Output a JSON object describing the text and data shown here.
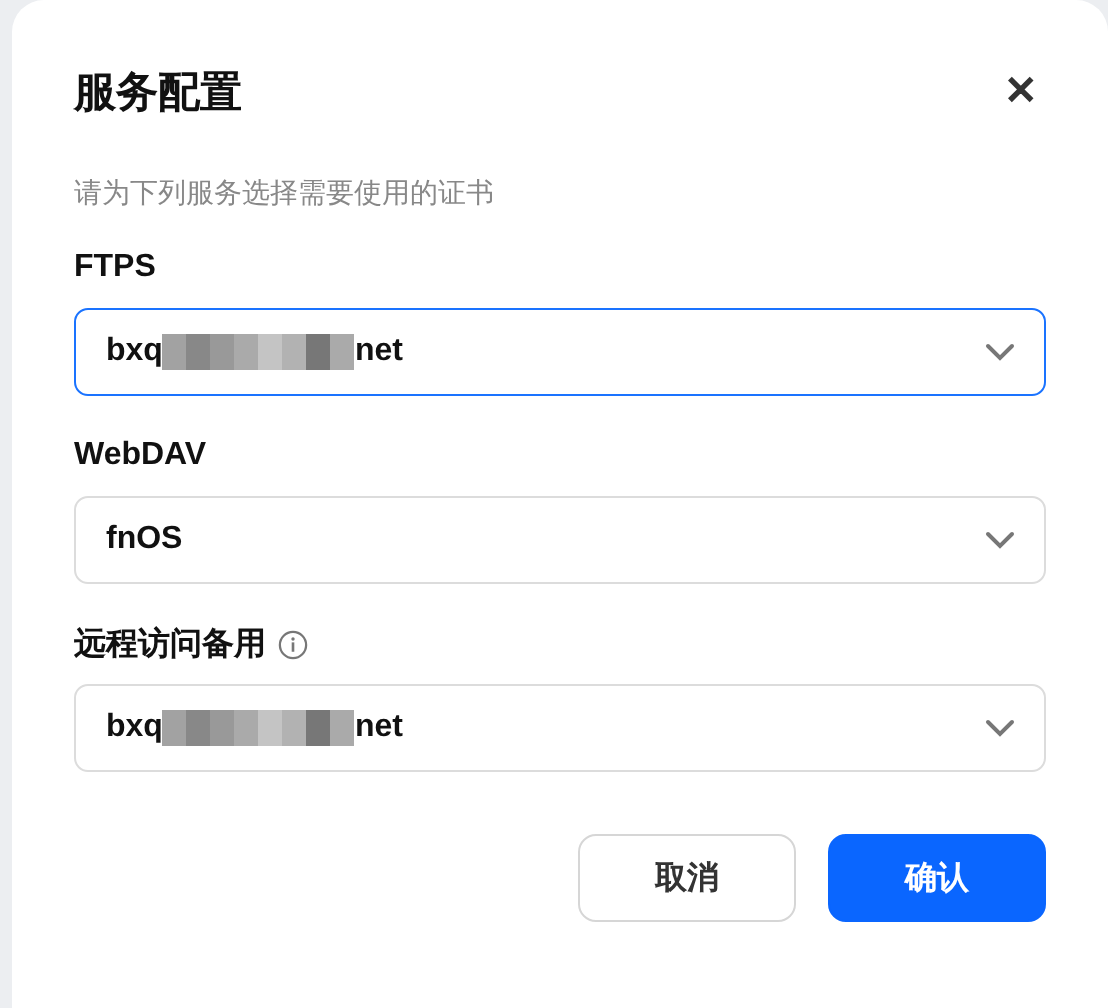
{
  "dialog": {
    "title": "服务配置",
    "close": "✕",
    "description": "请为下列服务选择需要使用的证书"
  },
  "fields": [
    {
      "label": "FTPS",
      "focused": true,
      "value": "bxq",
      "value_end": "net",
      "redacted": true
    },
    {
      "label": "WebDAV",
      "focused": false,
      "value": "fnOS"
    },
    {
      "label": "远程访问备用",
      "info": true,
      "focused": false,
      "value": "bxq",
      "value_end": "net",
      "redacted": true
    }
  ],
  "buttons": [
    {
      "label": "取消",
      "kind": "secondary"
    },
    {
      "label": "确认",
      "kind": "primary"
    }
  ]
}
